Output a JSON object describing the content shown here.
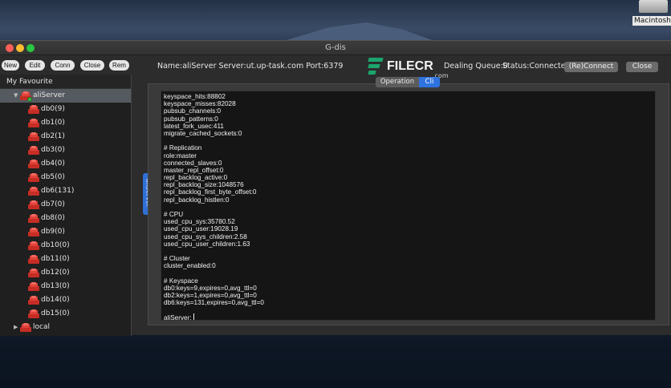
{
  "desktop": {
    "drive_label": "Macintosh H"
  },
  "window": {
    "title": "G-dis"
  },
  "toolbar": {
    "new_label": "New",
    "edit_label": "Edit",
    "conn_label": "Conn",
    "close_label": "Close",
    "rem_label": "Rem"
  },
  "sidebar": {
    "header": "My Favourite",
    "server": "aliServer",
    "databases": [
      "db0(9)",
      "db1(0)",
      "db2(1)",
      "db3(0)",
      "db4(0)",
      "db5(0)",
      "db6(131)",
      "db7(0)",
      "db8(0)",
      "db9(0)",
      "db10(0)",
      "db11(0)",
      "db12(0)",
      "db13(0)",
      "db14(0)",
      "db15(0)"
    ],
    "local": "local"
  },
  "side_tab": {
    "label": "aliServer"
  },
  "connection": {
    "info": "Name:aliServer Server:ut.up-task.com Port:6379",
    "queue": "Dealing Queue:0",
    "status": "Status:Connected",
    "reconnect_label": "(Re)Connect",
    "close_label": "Close"
  },
  "watermark": {
    "text": "FILECR",
    "sub": ".com"
  },
  "tabs": {
    "operation": "Operation",
    "cli": "Cli"
  },
  "console": {
    "lines": [
      "keyspace_hits:88802",
      "keyspace_misses:82028",
      "pubsub_channels:0",
      "pubsub_patterns:0",
      "latest_fork_usec:411",
      "migrate_cached_sockets:0",
      "",
      "# Replication",
      "role:master",
      "connected_slaves:0",
      "master_repl_offset:0",
      "repl_backlog_active:0",
      "repl_backlog_size:1048576",
      "repl_backlog_first_byte_offset:0",
      "repl_backlog_histlen:0",
      "",
      "# CPU",
      "used_cpu_sys:35780.52",
      "used_cpu_user:19028.19",
      "used_cpu_sys_children:2.58",
      "used_cpu_user_children:1.63",
      "",
      "# Cluster",
      "cluster_enabled:0",
      "",
      "# Keyspace",
      "db0:keys=9,expires=0,avg_ttl=0",
      "db2:keys=1,expires=0,avg_ttl=0",
      "db6:keys=131,expires=0,avg_ttl=0"
    ],
    "prompt": "aliServer:"
  },
  "colors": {
    "accent": "#2f73e0",
    "redis_red": "#c62d24",
    "connected_green": "#39b54a"
  }
}
